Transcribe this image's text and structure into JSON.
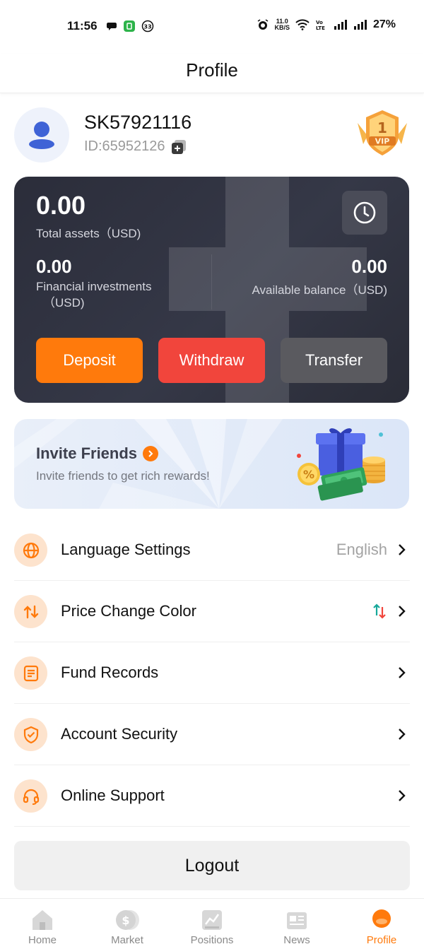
{
  "status_bar": {
    "time": "11:56",
    "speed_top": "11.0",
    "speed_bottom": "KB/S",
    "battery": "27%"
  },
  "header": {
    "title": "Profile"
  },
  "user": {
    "username": "SK57921116",
    "id_text": "ID:65952126",
    "vip_level": "1",
    "vip_label": "VIP"
  },
  "assets": {
    "total_value": "0.00",
    "total_label": "Total assets（USD)",
    "financial_value": "0.00",
    "financial_label_line1": "Financial investments",
    "financial_label_line2": "（USD)",
    "available_value": "0.00",
    "available_label": "Available balance（USD)",
    "deposit_label": "Deposit",
    "withdraw_label": "Withdraw",
    "transfer_label": "Transfer"
  },
  "invite": {
    "title": "Invite Friends",
    "subtitle": "Invite friends to get rich rewards!"
  },
  "menu": [
    {
      "label": "Language Settings",
      "value": "English",
      "icon": "globe-icon"
    },
    {
      "label": "Price Change Color",
      "value": "",
      "icon": "exchange-icon"
    },
    {
      "label": "Fund Records",
      "value": "",
      "icon": "document-icon"
    },
    {
      "label": "Account Security",
      "value": "",
      "icon": "shield-check-icon"
    },
    {
      "label": "Online Support",
      "value": "",
      "icon": "headset-icon"
    }
  ],
  "logout_label": "Logout",
  "nav": [
    {
      "label": "Home",
      "icon": "home-icon",
      "active": false
    },
    {
      "label": "Market",
      "icon": "dollar-coin-icon",
      "active": false
    },
    {
      "label": "Positions",
      "icon": "chart-icon",
      "active": false
    },
    {
      "label": "News",
      "icon": "newspaper-icon",
      "active": false
    },
    {
      "label": "Profile",
      "icon": "profile-icon",
      "active": true
    }
  ],
  "colors": {
    "accent": "#ff7a0c",
    "withdraw": "#f1453c",
    "transfer": "#5a5a5f",
    "card": "#2f3140",
    "up": "#17a89a",
    "down": "#f1453c"
  }
}
